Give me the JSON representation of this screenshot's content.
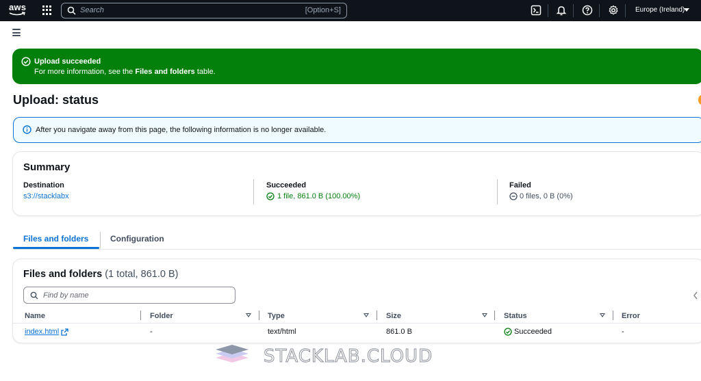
{
  "topnav": {
    "logo_text": "aws",
    "search_placeholder": "Search",
    "search_shortcut": "[Option+S]",
    "region": "Europe (Ireland)"
  },
  "flash": {
    "title": "Upload succeeded",
    "body_prefix": "For more information, see the ",
    "body_link": "Files and folders",
    "body_suffix": " table."
  },
  "page": {
    "title": "Upload: status"
  },
  "info": {
    "text": "After you navigate away from this page, the following information is no longer available."
  },
  "summary": {
    "title": "Summary",
    "destination_label": "Destination",
    "destination_value": "s3://stacklabx",
    "succeeded_label": "Succeeded",
    "succeeded_value": "1 file, 861.0 B (100.00%)",
    "failed_label": "Failed",
    "failed_value": "0 files, 0 B (0%)"
  },
  "tabs": [
    {
      "label": "Files and folders",
      "active": true
    },
    {
      "label": "Configuration",
      "active": false
    }
  ],
  "files": {
    "title": "Files and folders",
    "count": "(1 total, 861.0 B)",
    "filter_placeholder": "Find by name",
    "columns": [
      "Name",
      "Folder",
      "Type",
      "Size",
      "Status",
      "Error"
    ],
    "rows": [
      {
        "name": "index.html",
        "folder": "-",
        "type": "text/html",
        "size": "861.0 B",
        "status": "Succeeded",
        "error": "-"
      }
    ]
  },
  "watermark": {
    "text": "STACKLAB.CLOUD"
  },
  "colors": {
    "nav_bg": "#0f141a",
    "success": "#037f0c",
    "link": "#0972d3",
    "info_bg": "#f0fbff"
  }
}
